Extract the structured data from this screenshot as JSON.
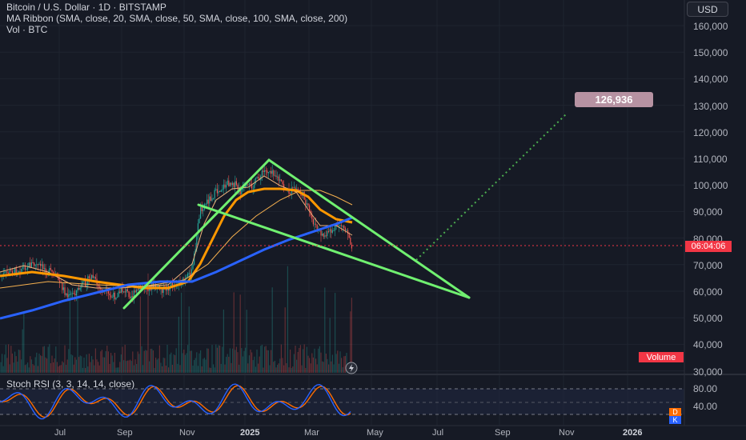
{
  "legend": {
    "symbol": "Bitcoin / U.S. Dollar · 1D · BITSTAMP",
    "ma_ribbon": "MA Ribbon (SMA, close, 20, SMA, close, 50, SMA, close, 100, SMA, close, 200)",
    "volume": "Vol · BTC"
  },
  "currency_button": "USD",
  "price_axis": [
    "160,000",
    "150,000",
    "140,000",
    "130,000",
    "120,000",
    "110,000",
    "100,000",
    "90,000",
    "80,000",
    "70,000",
    "60,000",
    "50,000",
    "40,000",
    "30,000"
  ],
  "countdown": "06:04:06",
  "target_label": "126,936",
  "volume_tag": "Volume",
  "rsi": {
    "legend": "Stoch RSI (3, 3, 14, 14, close)",
    "axis": [
      "80.00",
      "40.00"
    ],
    "d_label": "D",
    "k_label": "K"
  },
  "time_axis": [
    {
      "label": "Jul",
      "bold": false
    },
    {
      "label": "Sep",
      "bold": false
    },
    {
      "label": "Nov",
      "bold": false
    },
    {
      "label": "2025",
      "bold": true
    },
    {
      "label": "Mar",
      "bold": false
    },
    {
      "label": "May",
      "bold": false
    },
    {
      "label": "Jul",
      "bold": false
    },
    {
      "label": "Sep",
      "bold": false
    },
    {
      "label": "Nov",
      "bold": false
    },
    {
      "label": "2026",
      "bold": true
    }
  ],
  "colors": {
    "background": "#161a25",
    "up": "#26a69a",
    "down": "#ef5350",
    "sma20": "#f0b27a",
    "sma50": "#ff9800",
    "sma200": "#2962ff",
    "trendline": "#70f070",
    "projection": "#4caf50",
    "stoch_k": "#2962ff",
    "stoch_d": "#ff6d00"
  }
}
